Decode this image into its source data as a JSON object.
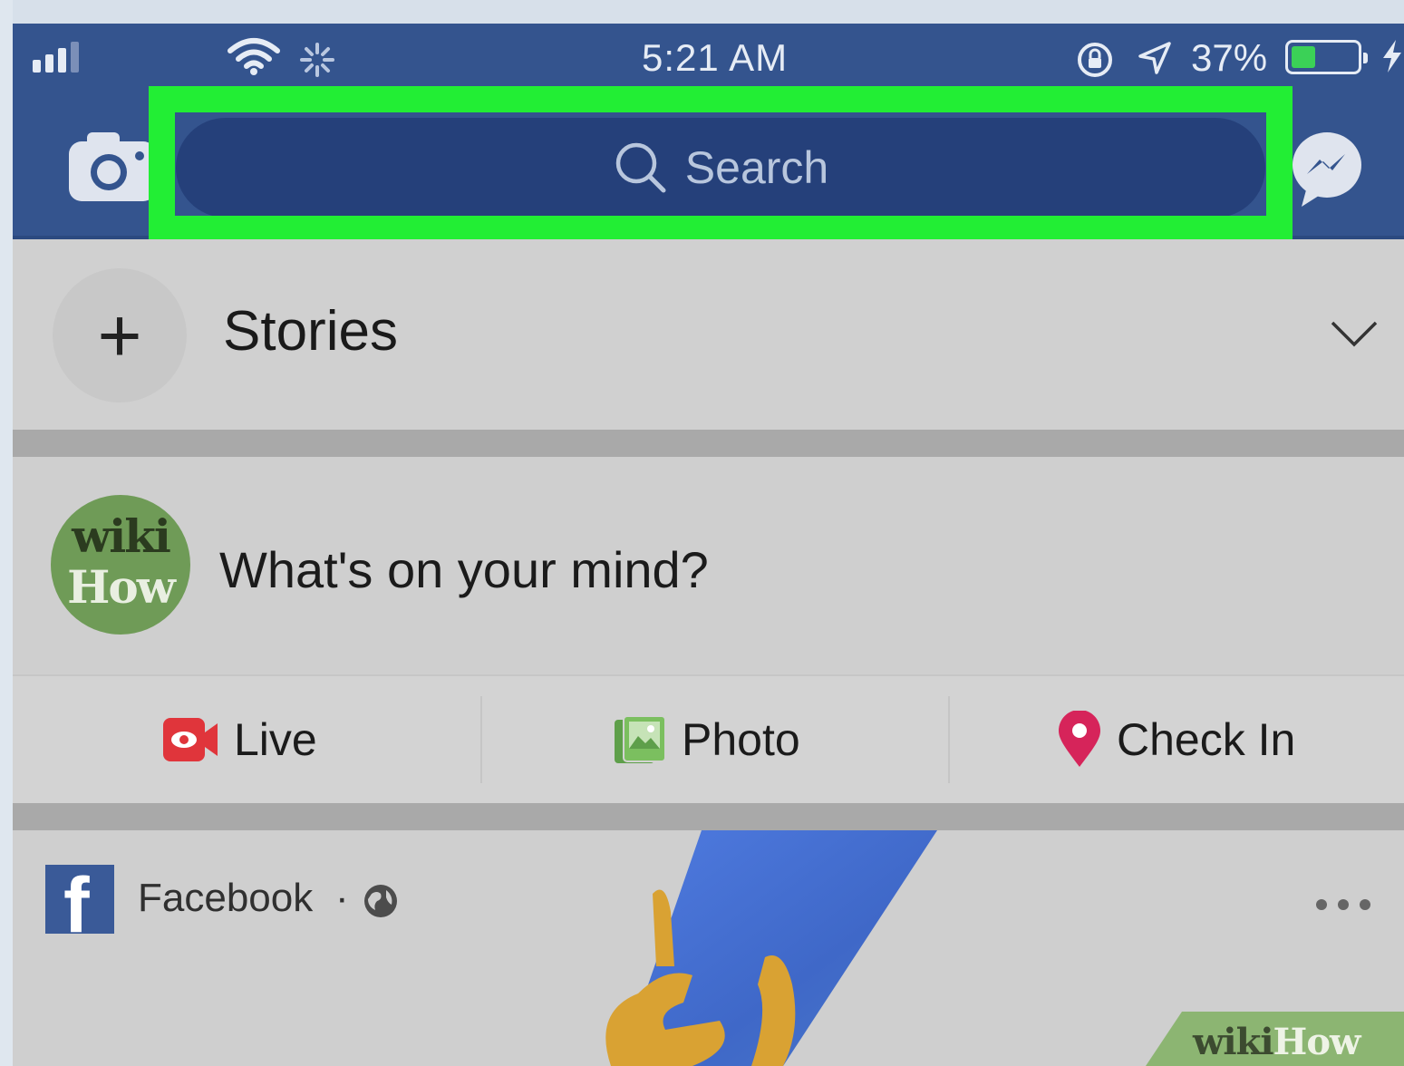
{
  "status_bar": {
    "time": "5:21 AM",
    "battery_percent": "37%",
    "battery_level": 0.37,
    "icons": [
      "signal-icon",
      "wifi-icon",
      "activity-spinner-icon",
      "rotation-lock-icon",
      "location-arrow-icon",
      "battery-icon",
      "charging-bolt-icon"
    ]
  },
  "header": {
    "search_placeholder": "Search",
    "highlight_color": "#22ee34",
    "bar_color": "#34548e"
  },
  "stories": {
    "label": "Stories"
  },
  "composer": {
    "avatar_top": "wiki",
    "avatar_bottom": "How",
    "prompt": "What's on your mind?"
  },
  "actions": {
    "live": "Live",
    "photo": "Photo",
    "check_in": "Check In"
  },
  "post": {
    "page_name": "Facebook",
    "separator": "·"
  },
  "watermark": {
    "part1": "wiki",
    "part2": "How"
  }
}
